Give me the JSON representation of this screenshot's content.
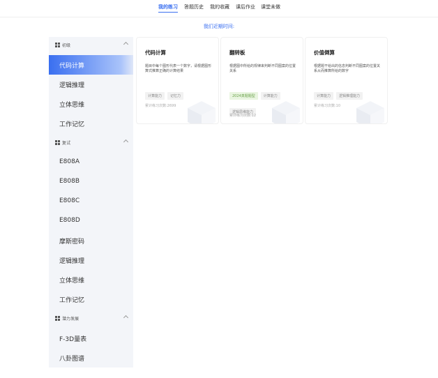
{
  "nav": {
    "tabs": [
      {
        "label": "我的练习",
        "active": true
      },
      {
        "label": "答题历史",
        "active": false
      },
      {
        "label": "我的收藏",
        "active": false
      },
      {
        "label": "课后作业",
        "active": false
      },
      {
        "label": "课堂未做",
        "active": false
      }
    ]
  },
  "banner": {
    "text": "我们近期时间:"
  },
  "sidebar": {
    "sections": [
      {
        "title": "初级",
        "items": [
          "代码计算",
          "逻辑推理",
          "立体思维",
          "工作记忆"
        ]
      },
      {
        "title": "复试",
        "items": [
          "E808A",
          "E808B",
          "E808C",
          "E808D",
          "摩斯密码",
          "逻辑推理",
          "立体思维",
          "工作记忆"
        ]
      },
      {
        "title": "潜力发展",
        "items": [
          "F-3D量表",
          "八卦图谱"
        ]
      }
    ]
  },
  "cards": [
    {
      "title": "代码计算",
      "desc": "题目中每个图形代表一个数字，请根据图形算式推算正确的计算结果",
      "tags": [
        {
          "label": "计算能力",
          "style": "gray"
        },
        {
          "label": "记忆力",
          "style": "gray"
        }
      ],
      "count": "累计练习次数:2699"
    },
    {
      "title": "翻转板",
      "desc": "根据图中所给的规律来判断不同图案的位置关系",
      "tags": [
        {
          "label": "2024真题题型",
          "style": "green"
        },
        {
          "label": "计算能力",
          "style": "gray"
        },
        {
          "label": "逻辑思维能力",
          "style": "gray"
        }
      ],
      "count": "累计练习次数:12"
    },
    {
      "title": "价值倒算",
      "desc": "根据题干给出的信息判断不同图案的位置关系从而推算所给的数字",
      "tags": [
        {
          "label": "计算能力",
          "style": "gray"
        },
        {
          "label": "逻辑推理能力",
          "style": "gray"
        }
      ],
      "count": "累计练习次数:10"
    }
  ],
  "colors": {
    "accent": "#3a6ff0",
    "sidebar_bg": "#f3f5f9"
  }
}
